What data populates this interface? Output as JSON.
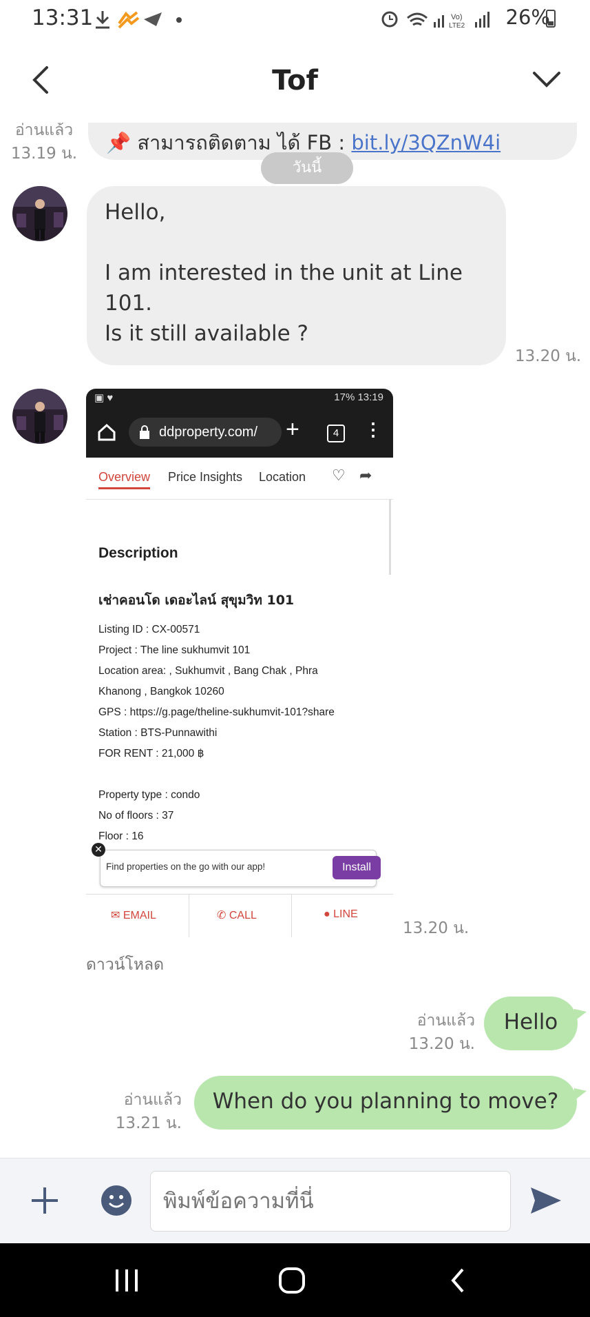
{
  "status_bar": {
    "time": "13:31",
    "battery": "26%"
  },
  "header": {
    "title": "Tof"
  },
  "messages": {
    "prev": {
      "read": "อ่านแล้ว",
      "time": "13.19 น.",
      "text_prefix": "📌 สามารถติดตาม ได้ FB : ",
      "link": "bit.ly/3QZnW4i"
    },
    "date_chip": "วันนี้",
    "incoming_text": {
      "line1": "Hello,",
      "line2": "I am interested in the unit at Line",
      "line3": "101.",
      "line4": "Is it still available ?",
      "time": "13.20 น."
    },
    "incoming_image": {
      "time": "13.20 น.",
      "download_label": "ดาวน์โหลด",
      "shot": {
        "status": "17%  13:19",
        "url": "ddproperty.com/",
        "tabs_badge": "4",
        "tabs": [
          "Overview",
          "Price Insights",
          "Location"
        ],
        "heading": "Description",
        "thai_title": "เช่าคอนโด เดอะไลน์ สุขุมวิท 101",
        "lines": [
          "Listing ID : CX-00571",
          "Project : The line sukhumvit 101",
          "Location area: , Sukhumvit , Bang Chak , Phra",
          "Khanong , Bangkok 10260",
          "GPS : https://g.page/theline-sukhumvit-101?share",
          "Station : BTS-Punnawithi",
          "FOR RENT : 21,000 ฿"
        ],
        "lines2": [
          "Property type : condo",
          "No of floors : 37",
          "Floor : 16"
        ],
        "banner_text": "Find properties on the go with our app!",
        "install": "Install",
        "actions": [
          "EMAIL",
          "CALL",
          "LINE"
        ]
      }
    },
    "out1": {
      "read": "อ่านแล้ว",
      "time": "13.20 น.",
      "text": "Hello"
    },
    "out2": {
      "read": "อ่านแล้ว",
      "time": "13.21 น.",
      "text": "When do you planning to move?"
    }
  },
  "input": {
    "placeholder": "พิมพ์ข้อความที่นี่"
  },
  "icons": [
    "back-icon",
    "chevron-down-icon",
    "plus-icon",
    "emoji-icon",
    "send-icon",
    "recents-icon",
    "home-icon",
    "nav-back-icon"
  ]
}
